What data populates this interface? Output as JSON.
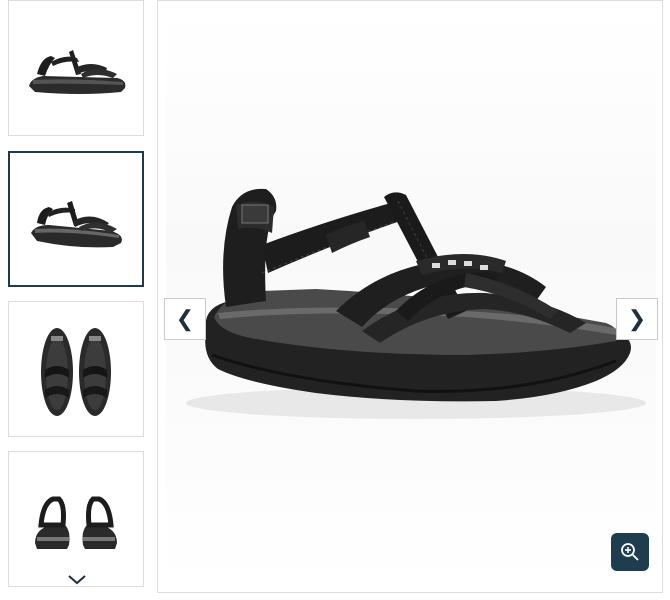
{
  "gallery": {
    "thumbnails": [
      {
        "icon": "sandal-side-view-thumbnail",
        "active": false
      },
      {
        "icon": "sandal-angle-view-thumbnail",
        "active": true
      },
      {
        "icon": "sandal-top-view-thumbnail",
        "active": false
      },
      {
        "icon": "sandal-back-view-thumbnail",
        "active": false
      }
    ],
    "scroll_down_icon": "chevron-down-icon",
    "prev_label": "❮",
    "next_label": "❯",
    "zoom_icon": "zoom-in-icon",
    "main_image_icon": "black-leather-sandal"
  },
  "colors": {
    "active_border": "#1f3a4a",
    "zoom_button": "#1e3d4f",
    "arrow": "#1f2f3c",
    "border": "#dcdcdc"
  }
}
